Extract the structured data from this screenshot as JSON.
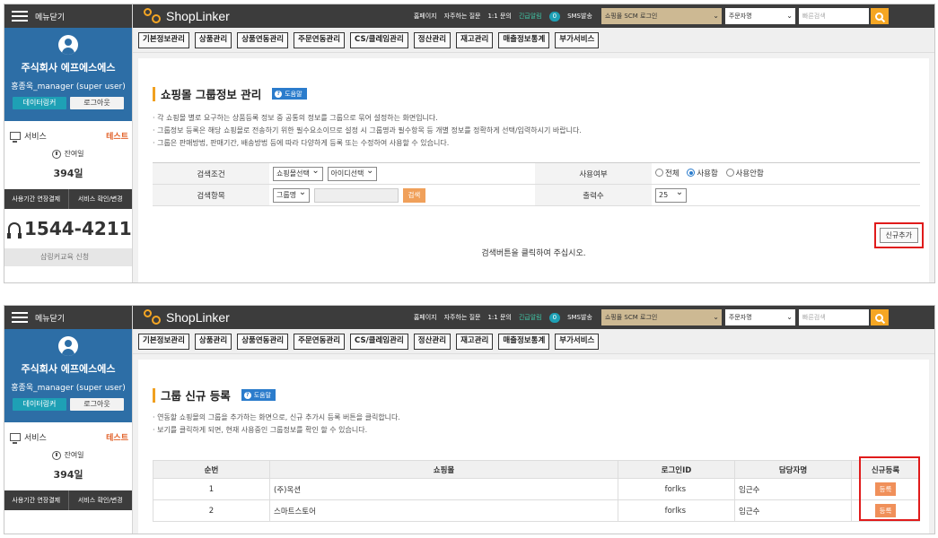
{
  "sidebar": {
    "menu_close": "메뉴닫기",
    "company": "주식회사 에프에스에스",
    "user": "홍종욱_manager (super user)",
    "btn_datalinker": "데이터링커",
    "btn_logout": "로그아웃",
    "service": "서비스",
    "test": "테스트",
    "remain_label": "잔여일",
    "remain_days": "394일",
    "btn_extend": "사용기간 연장결제",
    "btn_service_change": "서비스 확인/변경",
    "phone": "1544-4211",
    "partial_btn": "샵링커교육 신청"
  },
  "topbar": {
    "logo": "ShopLinker",
    "links": [
      "홈페이지",
      "자주하는 질문",
      "1:1 문의"
    ],
    "urgent_label": "긴급알림",
    "urgent_count": "0",
    "sms": "SMS발송",
    "scm_login": "쇼핑몰 SCM 로그인",
    "order_select": "주문자명",
    "quick_search": "빠른검색"
  },
  "tabs": [
    "기본정보관리",
    "상품관리",
    "상품연동관리",
    "주문연동관리",
    "CS/클레임관리",
    "정산관리",
    "재고관리",
    "매출정보통계",
    "부가서비스"
  ],
  "panel1": {
    "title": "쇼핑몰 그룹정보 관리",
    "help": "도움말",
    "desc": [
      "· 각 쇼핑몰 별로 요구하는 상품등록 정보 중 공통의 정보를 그룹으로 묶어 설정하는 화면입니다.",
      "· 그룹정보 등록은 해당 쇼핑몰로 전송하기 위한 필수요소이므로 설정 시 그룹명과 필수항목 등 개별 정보를 정확하게 선택/입력하시기 바랍니다.",
      "· 그룹은 판매방법, 판매기간, 배송방법 등에 따라 다양하게 등록 또는 수정하여 사용할 수 있습니다."
    ],
    "form": {
      "cond_label": "검색조건",
      "cond_sel1": "쇼핑몰선택",
      "cond_sel2": "아이디선택",
      "use_label": "사용여부",
      "use_opts": [
        "전체",
        "사용함",
        "사용안함"
      ],
      "item_label": "검색항목",
      "item_sel": "그룹명",
      "search_btn": "검색",
      "count_label": "출력수",
      "count_sel": "25"
    },
    "new_btn": "신규추가",
    "prompt": "검색버튼을 클릭하여 주십시오."
  },
  "panel2": {
    "title": "그룹 신규 등록",
    "help": "도움말",
    "desc": [
      "· 연동할 쇼핑몰의 그룹을 추가하는 화면으로, 신규 추가시 등록 버튼을 클릭합니다.",
      "· 보기를 클릭하게 되면, 현재 사용중인 그룹정보를 확인 할 수 있습니다."
    ],
    "table": {
      "headers": [
        "순번",
        "쇼핑몰",
        "로그인ID",
        "담당자명",
        "신규등록"
      ],
      "rows": [
        {
          "no": "1",
          "mall": "(주)옥션",
          "login": "forlks",
          "manager": "임근수",
          "btn": "등록"
        },
        {
          "no": "2",
          "mall": "스마트스토어",
          "login": "forlks",
          "manager": "임근수",
          "btn": "등록"
        }
      ]
    }
  },
  "colors": {
    "accent": "#2d6ea6",
    "orange": "#f0a05a",
    "highlight": "#e01b1b"
  }
}
